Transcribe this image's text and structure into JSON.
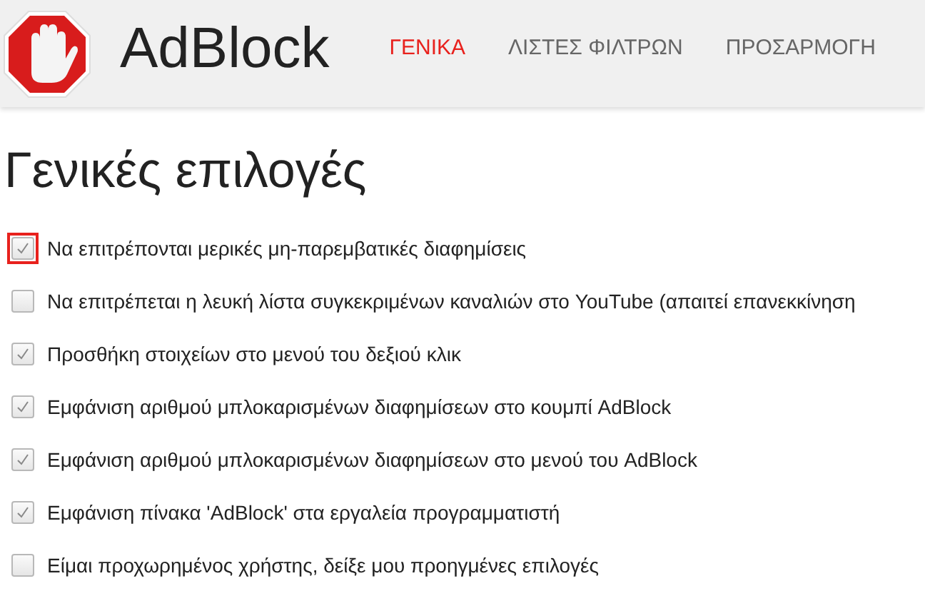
{
  "header": {
    "brand": "AdBlock",
    "tabs": [
      {
        "label": "ΓΕΝΙΚΑ",
        "selected": true
      },
      {
        "label": "ΛΙΣΤΕΣ ΦΙΛΤΡΩΝ",
        "selected": false
      },
      {
        "label": "ΠΡΟΣΑΡΜΟΓΗ",
        "selected": false
      }
    ]
  },
  "title": "Γενικές επιλογές",
  "options": [
    {
      "label": "Να επιτρέπονται μερικές μη-παρεμβατικές διαφημίσεις",
      "checked": true,
      "highlighted": true
    },
    {
      "label": "Να επιτρέπεται η λευκή λίστα συγκεκριμένων καναλιών στο YouTube (απαιτεί επανεκκίνηση",
      "checked": false,
      "highlighted": false
    },
    {
      "label": "Προσθήκη στοιχείων στο μενού του δεξιού κλικ",
      "checked": true,
      "highlighted": false
    },
    {
      "label": "Εμφάνιση αριθμού μπλοκαρισμένων διαφημίσεων στο κουμπί AdBlock",
      "checked": true,
      "highlighted": false
    },
    {
      "label": "Εμφάνιση αριθμού μπλοκαρισμένων διαφημίσεων στο μενού του AdBlock",
      "checked": true,
      "highlighted": false
    },
    {
      "label": "Εμφάνιση πίνακα 'AdBlock' στα εργαλεία προγραμματιστή",
      "checked": true,
      "highlighted": false
    },
    {
      "label": "Είμαι προχωρημένος χρήστης, δείξε μου προηγμένες επιλογές",
      "checked": false,
      "highlighted": false
    }
  ]
}
